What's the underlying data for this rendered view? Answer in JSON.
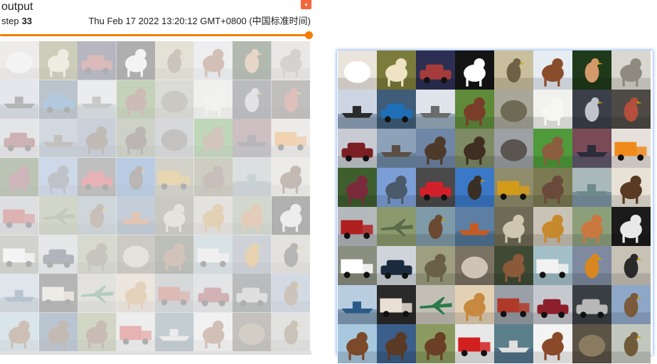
{
  "card": {
    "title": "output",
    "step_label": "step",
    "step_value": "33",
    "timestamp": "Thu Feb 17 2022 13:20:12 GMT+0800 (中国标准时间)",
    "accent_color": "#f57c00",
    "menu_icon": "more-vert-icon",
    "slider_value": 1.0
  },
  "tiles": [
    {
      "bg": "#e9e4dc",
      "fg": "#ffffff",
      "shape": "blob"
    },
    {
      "bg": "#7b7c3b",
      "fg": "#efe3c3",
      "shape": "animal"
    },
    {
      "bg": "#2c2f52",
      "fg": "#a63b3b",
      "shape": "car"
    },
    {
      "bg": "#141414",
      "fg": "#ffffff",
      "shape": "animal"
    },
    {
      "bg": "#c9bf9c",
      "fg": "#6e6145",
      "shape": "bird"
    },
    {
      "bg": "#e5ecf2",
      "fg": "#8a4d2c",
      "shape": "animal"
    },
    {
      "bg": "#1f3a1a",
      "fg": "#d39a6a",
      "shape": "bird"
    },
    {
      "bg": "#d9d7cf",
      "fg": "#8f8a80",
      "shape": "animal"
    },
    {
      "bg": "#cdd5e3",
      "fg": "#2a2a2a",
      "shape": "ship"
    },
    {
      "bg": "#3f5d78",
      "fg": "#1f6fb8",
      "shape": "car"
    },
    {
      "bg": "#dfe4ea",
      "fg": "#6b6b6b",
      "shape": "ship"
    },
    {
      "bg": "#5f8a3a",
      "fg": "#7a3d2a",
      "shape": "animal"
    },
    {
      "bg": "#a8a79a",
      "fg": "#6f6a55",
      "shape": "blob"
    },
    {
      "bg": "#f1f1ee",
      "fg": "#f7f7f2",
      "shape": "animal"
    },
    {
      "bg": "#3a3f4a",
      "fg": "#c2c4cc",
      "shape": "bird"
    },
    {
      "bg": "#4e4a45",
      "fg": "#b34f3c",
      "shape": "bird"
    },
    {
      "bg": "#c8ccd2",
      "fg": "#7c1f22",
      "shape": "car"
    },
    {
      "bg": "#8da2b8",
      "fg": "#5b4f45",
      "shape": "ship"
    },
    {
      "bg": "#6f86a6",
      "fg": "#4e3a2a",
      "shape": "animal"
    },
    {
      "bg": "#7d8a63",
      "fg": "#3f2e22",
      "shape": "animal"
    },
    {
      "bg": "#9da0a5",
      "fg": "#5a564f",
      "shape": "blob"
    },
    {
      "bg": "#4f9b3b",
      "fg": "#8a5e3f",
      "shape": "animal"
    },
    {
      "bg": "#7a4a56",
      "fg": "#2c2c3a",
      "shape": "ship"
    },
    {
      "bg": "#e5e0da",
      "fg": "#f08a1c",
      "shape": "truck"
    },
    {
      "bg": "#3f5e2e",
      "fg": "#7a2a3a",
      "shape": "animal"
    },
    {
      "bg": "#7c9ed6",
      "fg": "#4b5a6a",
      "shape": "animal"
    },
    {
      "bg": "#4a4a4a",
      "fg": "#d2202a",
      "shape": "car"
    },
    {
      "bg": "#3b78c8",
      "fg": "#3a2f25",
      "shape": "bird"
    },
    {
      "bg": "#8f8d6c",
      "fg": "#d49a1a",
      "shape": "truck"
    },
    {
      "bg": "#7c7a52",
      "fg": "#6a4a3a",
      "shape": "animal"
    },
    {
      "bg": "#a9b8b8",
      "fg": "#6e8a8c",
      "shape": "ship"
    },
    {
      "bg": "#e8e2d6",
      "fg": "#5a3a22",
      "shape": "animal"
    },
    {
      "bg": "#b4b9bd",
      "fg": "#b01f1f",
      "shape": "truck"
    },
    {
      "bg": "#8b9a6c",
      "fg": "#5b6a4a",
      "shape": "plane"
    },
    {
      "bg": "#7f9aa8",
      "fg": "#6a4a33",
      "shape": "bird"
    },
    {
      "bg": "#5c7fa3",
      "fg": "#c55b22",
      "shape": "ship"
    },
    {
      "bg": "#6e6a55",
      "fg": "#cfc6b0",
      "shape": "animal"
    },
    {
      "bg": "#c9c2b6",
      "fg": "#c7892e",
      "shape": "animal"
    },
    {
      "bg": "#8ba07a",
      "fg": "#c97840",
      "shape": "animal"
    },
    {
      "bg": "#1b1b1b",
      "fg": "#e8e8e8",
      "shape": "animal"
    },
    {
      "bg": "#8a8f80",
      "fg": "#ffffff",
      "shape": "truck"
    },
    {
      "bg": "#cfd4da",
      "fg": "#1c2a3f",
      "shape": "car"
    },
    {
      "bg": "#9d9f80",
      "fg": "#6a6048",
      "shape": "animal"
    },
    {
      "bg": "#7c7264",
      "fg": "#cfc3b5",
      "shape": "blob"
    },
    {
      "bg": "#3f4a34",
      "fg": "#8a5a3a",
      "shape": "animal"
    },
    {
      "bg": "#a3c0c8",
      "fg": "#f2f2f2",
      "shape": "truck"
    },
    {
      "bg": "#7f8aa0",
      "fg": "#d8871e",
      "shape": "bird"
    },
    {
      "bg": "#c8c2b6",
      "fg": "#2a2a2a",
      "shape": "bird"
    },
    {
      "bg": "#b9cde0",
      "fg": "#2b5a86",
      "shape": "ship"
    },
    {
      "bg": "#2a2a2a",
      "fg": "#e9dfd2",
      "shape": "truck"
    },
    {
      "bg": "#c4bfb6",
      "fg": "#2a7a4a",
      "shape": "plane"
    },
    {
      "bg": "#e3d1b4",
      "fg": "#c78840",
      "shape": "animal"
    },
    {
      "bg": "#9aa0a8",
      "fg": "#b03a2a",
      "shape": "truck"
    },
    {
      "bg": "#c5c8cf",
      "fg": "#8c1f2a",
      "shape": "car"
    },
    {
      "bg": "#3a3f44",
      "fg": "#b8b8b8",
      "shape": "car"
    },
    {
      "bg": "#8ea7c8",
      "fg": "#7a5a3a",
      "shape": "bird"
    },
    {
      "bg": "#a8c8e0",
      "fg": "#7a4a2a",
      "shape": "animal"
    },
    {
      "bg": "#3b5f8a",
      "fg": "#5a3a25",
      "shape": "animal"
    },
    {
      "bg": "#8a9a60",
      "fg": "#6a3f25",
      "shape": "animal"
    },
    {
      "bg": "#e8e8e8",
      "fg": "#d21f1f",
      "shape": "truck"
    },
    {
      "bg": "#5c7f8c",
      "fg": "#e0e0e0",
      "shape": "ship"
    },
    {
      "bg": "#f4f4f4",
      "fg": "#8a4a2a",
      "shape": "animal"
    },
    {
      "bg": "#5c5347",
      "fg": "#8a7a60",
      "shape": "blob"
    },
    {
      "bg": "#c2c7bd",
      "fg": "#6f5a3a",
      "shape": "bird"
    }
  ]
}
